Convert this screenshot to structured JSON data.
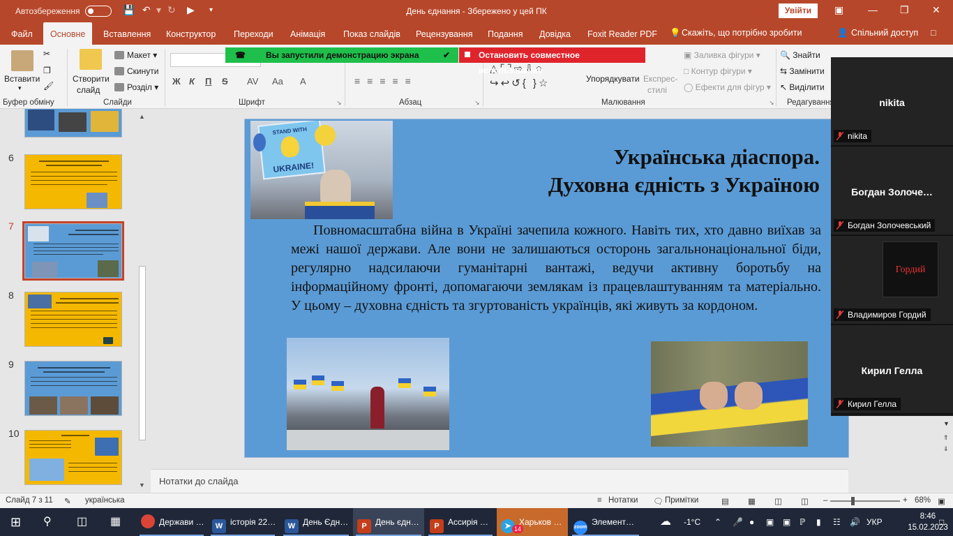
{
  "titlebar": {
    "autosave_label": "Автозбереження",
    "autosave_state": "off",
    "document_title": "День єднання  -  Збережено у цей ПК",
    "signin_label": "Увійти"
  },
  "ribbon_tabs": [
    {
      "label": "Файл"
    },
    {
      "label": "Основне",
      "active": true
    },
    {
      "label": "Вставлення"
    },
    {
      "label": "Конструктор"
    },
    {
      "label": "Переходи"
    },
    {
      "label": "Анімація"
    },
    {
      "label": "Показ слайдів"
    },
    {
      "label": "Рецензування"
    },
    {
      "label": "Подання"
    },
    {
      "label": "Довідка"
    },
    {
      "label": "Foxit Reader PDF"
    }
  ],
  "tellme": "Скажіть, що потрібно зробити",
  "share_label": "Спільний доступ",
  "ribbon": {
    "clipboard": {
      "paste": "Вставити",
      "group": "Буфер обміну"
    },
    "slides": {
      "new_slide_1": "Створити",
      "new_slide_2": "слайд",
      "layout": "Макет",
      "reset": "Скинути",
      "section": "Розділ",
      "group": "Слайди"
    },
    "font": {
      "group": "Шрифт",
      "bold": "Ж",
      "italic": "К",
      "underline": "П",
      "strike": "S",
      "spacing": "AV",
      "case": "Aa"
    },
    "paragraph": {
      "group": "Абзац"
    },
    "drawing": {
      "arrange": "Упорядкувати",
      "quick_styles_1": "Експрес-",
      "quick_styles_2": "стилі",
      "fill": "Заливка фігури",
      "outline": "Контур фігури",
      "effects": "Ефекти для фігур",
      "group": "Малювання"
    },
    "editing": {
      "find": "Знайти",
      "replace": "Замінити",
      "select": "Виділити",
      "group": "Редагування"
    }
  },
  "screenshare": {
    "green_banner": "Вы запустили демонстрацию экрана",
    "red_banner": "Остановить совместное использование"
  },
  "thumbnails": [
    {
      "number": "6",
      "bg": "#f5b800"
    },
    {
      "number": "7",
      "bg": "#5b9bd5",
      "selected": true
    },
    {
      "number": "8",
      "bg": "#f5b800"
    },
    {
      "number": "9",
      "bg": "#5b9bd5"
    },
    {
      "number": "10",
      "bg": "#f5b800"
    }
  ],
  "slide": {
    "title_line1": "Українська діаспора.",
    "title_line2": "Духовна єдність з  Україною",
    "body": "Повномасштабна війна в Україні зачепила кожного. Навіть тих, хто давно виїхав за межі нашої держави. Але вони не залишаються осторонь загальнонаціональної біди, регулярно надсилаючи гуманітарні вантажі, ведучи активну боротьбу на інформаційному фронті, допомагаючи землякам із працевлаштуванням та  матеріально. У цьому – духовна єдність та згуртованість українців, які живуть за кордоном.",
    "photo1_sign_top": "STAND WITH",
    "photo1_sign_main": "UKRAINE!"
  },
  "notes_placeholder": "Нотатки до слайда",
  "statusbar": {
    "slide_counter": "Слайд 7 з 11",
    "language": "українська",
    "notes": "Нотатки",
    "comments": "Примітки",
    "zoom": "68%"
  },
  "participants": [
    {
      "display": "nikita",
      "label": "nikita"
    },
    {
      "display": "Богдан  Золоче…",
      "label": "Богдан Золочевський"
    },
    {
      "display": "Гордий",
      "label": "Владимиров Гордий"
    },
    {
      "display": "Кирил Гелла",
      "label": "Кирил Гелла"
    }
  ],
  "taskbar": {
    "items": [
      {
        "label": "Держави …",
        "icon": "chrome-icon",
        "color": "#db4437"
      },
      {
        "label": "історія 22…",
        "icon": "word-icon",
        "color": "#2b579a"
      },
      {
        "label": "День Єдн…",
        "icon": "word-icon",
        "color": "#2b579a"
      },
      {
        "label": "День єдн…",
        "icon": "powerpoint-icon",
        "color": "#c43e1c",
        "active": true
      },
      {
        "label": "Ассирія …",
        "icon": "powerpoint-icon",
        "color": "#c43e1c"
      },
      {
        "label": "Харьков …",
        "icon": "telegram-icon",
        "color": "#2aa3df",
        "badge": "14"
      },
      {
        "label": "Элемент…",
        "icon": "zoom-icon",
        "color": "#2d8cff"
      }
    ],
    "weather": "-1°C",
    "language": "УКР",
    "time": "8:46",
    "date": "15.02.2023"
  }
}
